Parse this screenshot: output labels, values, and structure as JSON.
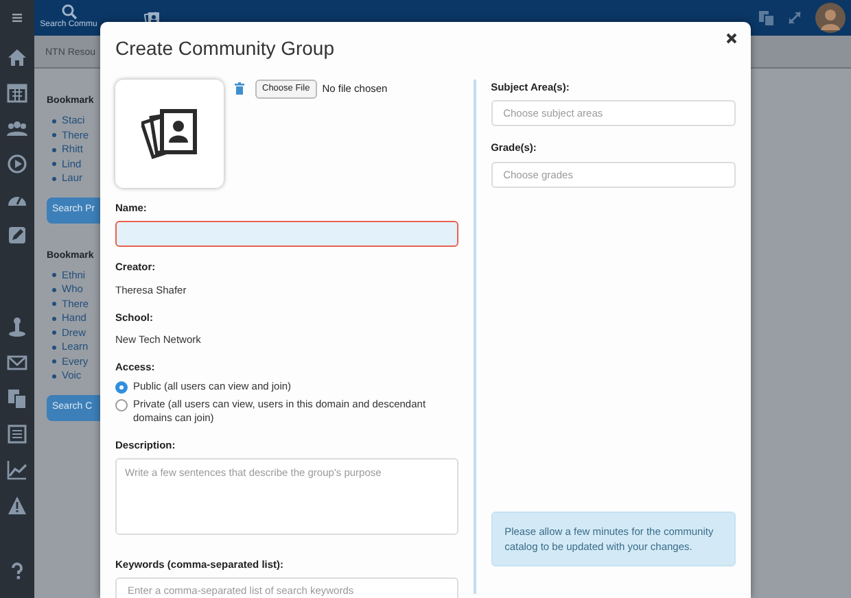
{
  "top_bar": {
    "search_label": "Search Commu"
  },
  "background_panel": {
    "tab": "NTN Resou",
    "sections": [
      {
        "heading": "Bookmark",
        "items": [
          "Staci",
          "There",
          "Rhitt",
          "Lind",
          "Laur"
        ],
        "button": "Search Pr"
      },
      {
        "heading": "Bookmark",
        "items": [
          "Ethni",
          "Who",
          "There",
          "Hand",
          "Drew",
          "Learn",
          "Every",
          "Voic"
        ],
        "button": "Search C"
      }
    ]
  },
  "modal": {
    "title": "Create Community Group",
    "file": {
      "button": "Choose File",
      "status": "No file chosen"
    },
    "name": {
      "label": "Name:",
      "invalid": true
    },
    "creator": {
      "label": "Creator:",
      "value": "Theresa Shafer"
    },
    "school": {
      "label": "School:",
      "value": "New Tech Network"
    },
    "access": {
      "label": "Access:",
      "options": [
        {
          "label": "Public (all users can view and join)",
          "selected": true
        },
        {
          "label": "Private (all users can view, users in this domain and descendant domains can join)",
          "selected": false
        }
      ]
    },
    "description": {
      "label": "Description:",
      "placeholder": "Write a few sentences that describe the group's purpose"
    },
    "keywords": {
      "label": "Keywords (comma-separated list):",
      "placeholder": "Enter a comma-separated list of search keywords"
    },
    "subjects": {
      "label": "Subject Area(s):",
      "placeholder": "Choose subject areas"
    },
    "grades": {
      "label": "Grade(s):",
      "placeholder": "Choose grades"
    },
    "notice": "Please allow a few minutes for the community catalog to be updated with your changes."
  }
}
